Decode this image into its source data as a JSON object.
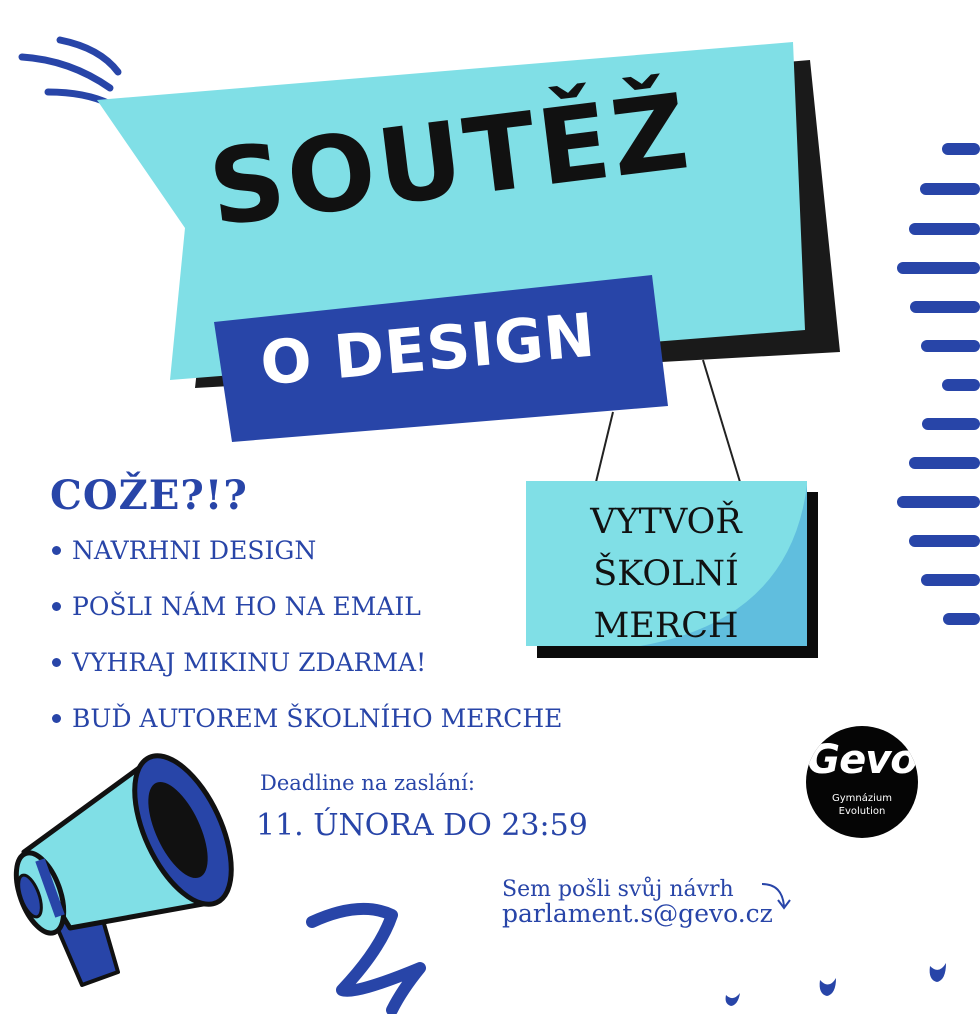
{
  "colors": {
    "navy": "#2845a8",
    "aqua": "#7fdfe6",
    "black": "#111111",
    "white": "#ffffff"
  },
  "headline": {
    "title": "SOUTĚŽ",
    "subtitle": "O DESIGN"
  },
  "sign": {
    "line1": "VYTVOŘ",
    "line2": "ŠKOLNÍ",
    "line3": "MERCH"
  },
  "info": {
    "heading": "COŽE?!?",
    "bullets": [
      "NAVRHNI DESIGN",
      "POŠLI NÁM HO NA EMAIL",
      "VYHRAJ MIKINU ZDARMA!",
      "BUĎ AUTOREM ŠKOLNÍHO MERCHE"
    ]
  },
  "deadline": {
    "label": "Deadline na zaslání:",
    "value": "11.  ÚNORA DO 23:59"
  },
  "contact": {
    "label": "Sem pošli svůj návrh",
    "email": "parlament.s@gevo.cz"
  },
  "logo": {
    "word": "Gevo",
    "line1": "Gymnázium",
    "line2": "Evolution"
  },
  "icons": [
    "megaphone-icon",
    "arrow-curve-icon",
    "sparkle-lines-icon"
  ]
}
